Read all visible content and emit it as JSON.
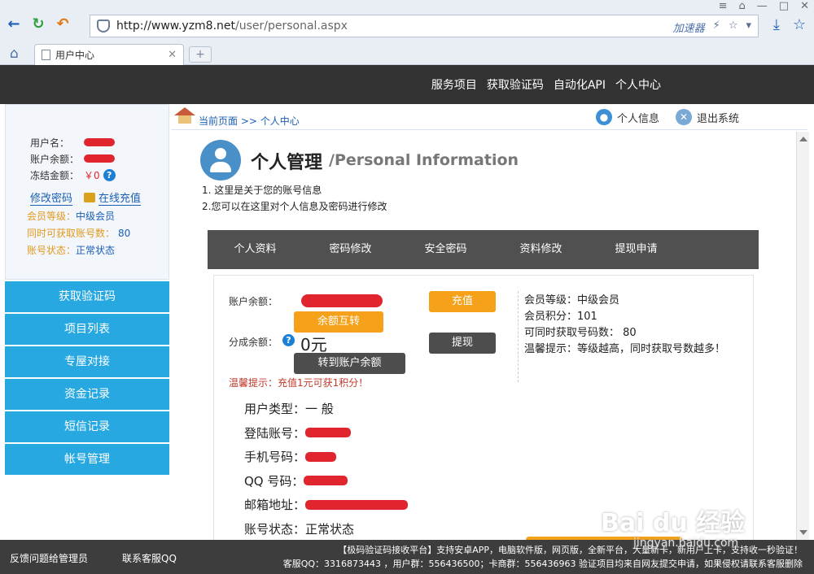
{
  "browser": {
    "url_host": "http://www.yzm8.net",
    "url_path": "/user/personal.aspx",
    "accelerator": "加速器",
    "tab_title": "用户中心",
    "new_tab": "+"
  },
  "nav": [
    "服务项目",
    "获取验证码",
    "自动化API",
    "个人中心"
  ],
  "user_info": {
    "username_label": "用户名：",
    "balance_label": "账户余额：",
    "frozen_label": "冻结金额：",
    "frozen_value": "￥0",
    "change_password": "修改密码",
    "recharge": "在线充值",
    "level_label": "会员等级：",
    "level_value": "中级会员",
    "max_label": "同时可获取账号数：",
    "max_value": "80",
    "status_label": "账号状态：",
    "status_value": "正常状态"
  },
  "menu": [
    "获取验证码",
    "项目列表",
    "专屋对接",
    "资金记录",
    "短信记录",
    "帐号管理"
  ],
  "breadcrumb": "当前页面 >> 个人中心",
  "tools": {
    "personal": "个人信息",
    "logout": "退出系统"
  },
  "title": {
    "main": "个人管理",
    "sub": "/Personal Information"
  },
  "intro": [
    "1. 这里是关于您的账号信息",
    "2.您可以在这里对个人信息及密码进行修改"
  ],
  "tabs": [
    "个人资料",
    "密码修改",
    "安全密码",
    "资料修改",
    "提现申请"
  ],
  "account": {
    "balance_label": "账户余额：",
    "share_label": "分成余额：",
    "share_value": "0元",
    "btn_transfer_balance": "余额互转",
    "btn_recharge": "充值",
    "btn_withdraw": "提现",
    "btn_to_account": "转到账户余额",
    "tip": "温馨提示：充值1元可获1积分！"
  },
  "right_info": [
    "会员等级：中级会员",
    "会员积分：101",
    "可同时获取号码数： 80",
    "温馨提示：等级越高，同时获取号数越多！"
  ],
  "details": {
    "type_label": "用户类型：",
    "type_value": "一 般",
    "login_label": "登陆账号：",
    "phone_label": "手机号码：",
    "qq_label": "QQ 号码：",
    "email_label": "邮箱地址：",
    "status_label": "账号状态：",
    "status_value": "正常状态"
  },
  "footer": {
    "feedback": "反馈问题给管理员",
    "contact": "联系客服QQ",
    "line1": "【极码验证码接收平台】支持安卓APP，电脑软件版，网页版，全新平台，大量新卡，新用户上卡，支持收一秒验证！",
    "line2": "客服QQ：3316873443 ，用户群：556436500；卡商群：556436963 验证项目均来自网友提交申请，如果侵权请联系客服删除"
  },
  "watermark": {
    "logo": "Bai du 经验",
    "sub": "jingyan.baidu.com"
  },
  "colors": {
    "menu_blue": "#27a8e1",
    "header_dark": "#333333",
    "orange": "#f5a11a",
    "redaction": "#e1252e"
  }
}
